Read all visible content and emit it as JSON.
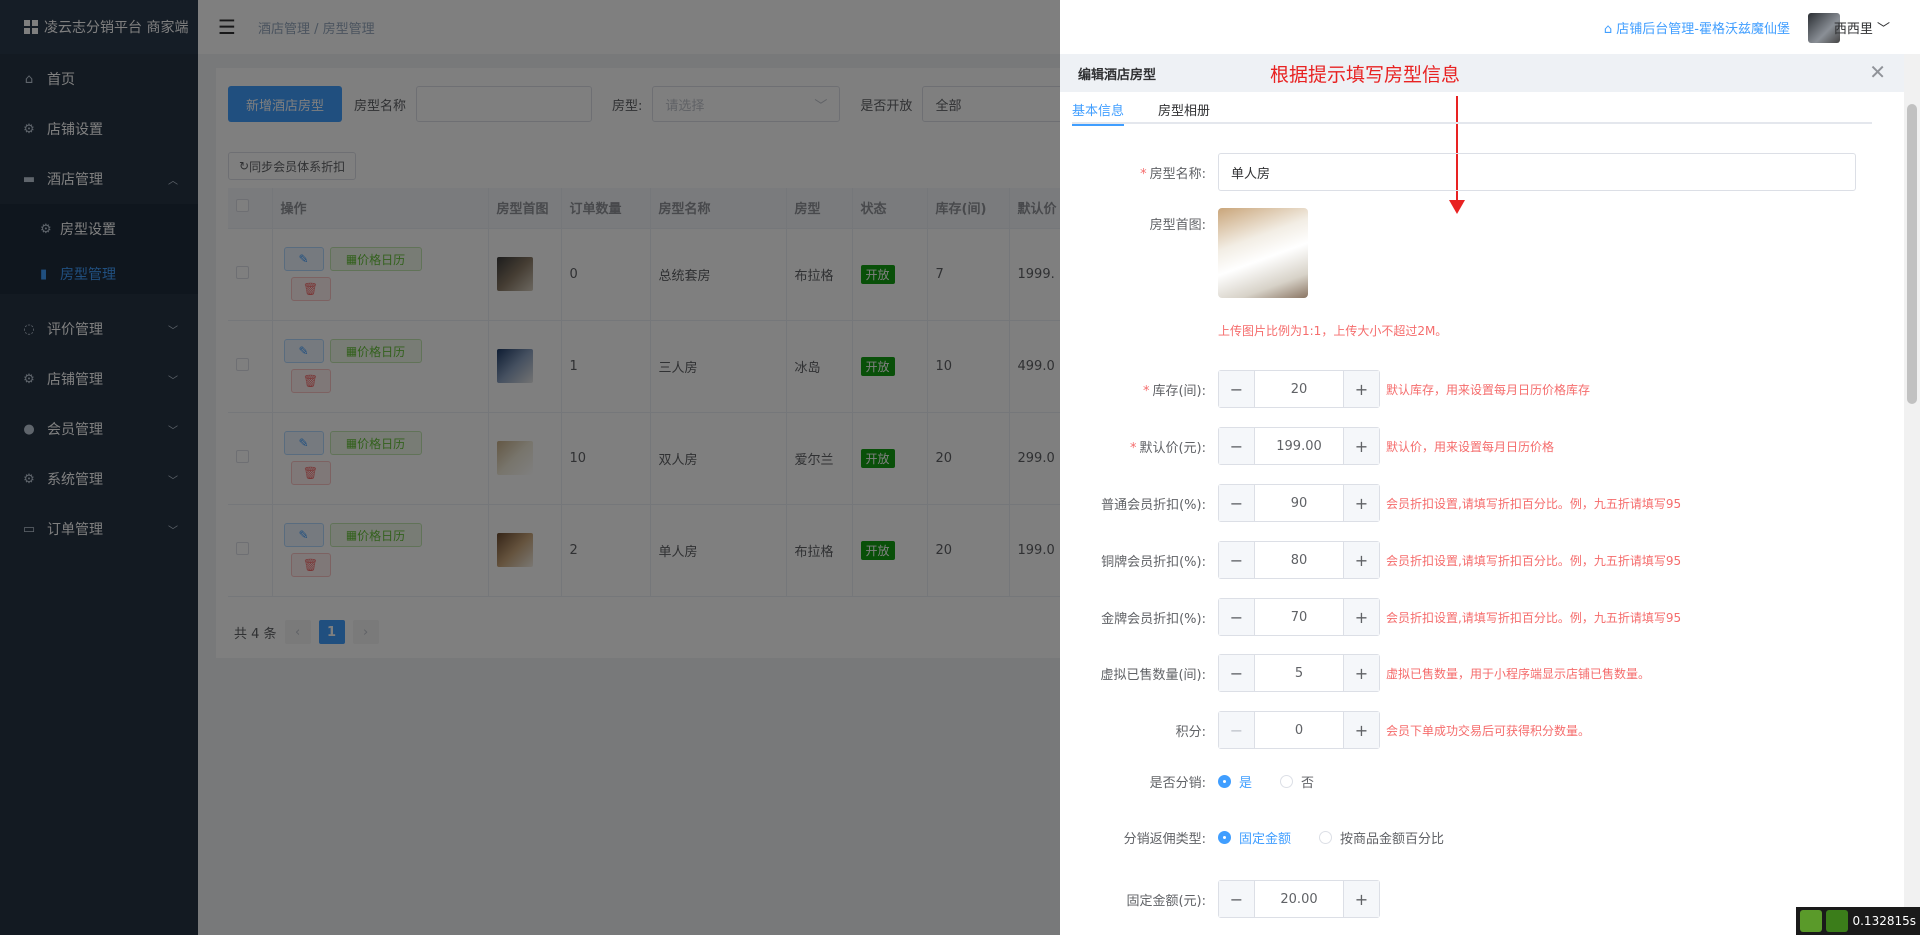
{
  "app": {
    "title": "凌云志分销平台 商家端"
  },
  "sidebar": {
    "items": [
      {
        "label": "首页",
        "icon": "home-icon"
      },
      {
        "label": "店铺设置",
        "icon": "gear-icon"
      },
      {
        "label": "酒店管理",
        "icon": "hotel-icon",
        "expanded": true,
        "children": [
          {
            "label": "房型设置"
          },
          {
            "label": "房型管理",
            "active": true
          }
        ]
      },
      {
        "label": "评价管理",
        "icon": "comment-icon"
      },
      {
        "label": "店铺管理",
        "icon": "gear-icon"
      },
      {
        "label": "会员管理",
        "icon": "user-icon"
      },
      {
        "label": "系统管理",
        "icon": "gear-icon"
      },
      {
        "label": "订单管理",
        "icon": "monitor-icon"
      }
    ]
  },
  "navbar": {
    "breadcrumb": "酒店管理 / 房型管理",
    "store_link": "店铺后台管理-霍格沃兹魔仙堡",
    "user": "西西里"
  },
  "toolbar": {
    "add_button": "新增酒店房型",
    "name_label": "房型名称",
    "type_label": "房型:",
    "type_placeholder": "请选择",
    "open_label": "是否开放",
    "open_value": "全部",
    "sync_button": "同步会员体系折扣"
  },
  "table": {
    "headers": [
      "操作",
      "房型首图",
      "订单数量",
      "房型名称",
      "房型",
      "状态",
      "库存(间)",
      "默认价"
    ],
    "calendar_label": "价格日历",
    "rows": [
      {
        "orders": "0",
        "name": "总统套房",
        "type": "布拉格",
        "status": "开放",
        "stock": "7",
        "price": "1999."
      },
      {
        "orders": "1",
        "name": "三人房",
        "type": "冰岛",
        "status": "开放",
        "stock": "10",
        "price": "499.0"
      },
      {
        "orders": "10",
        "name": "双人房",
        "type": "爱尔兰",
        "status": "开放",
        "stock": "20",
        "price": "299.0"
      },
      {
        "orders": "2",
        "name": "单人房",
        "type": "布拉格",
        "status": "开放",
        "stock": "20",
        "price": "199.0"
      }
    ]
  },
  "pagination": {
    "total": "共 4 条",
    "current": "1"
  },
  "drawer": {
    "title": "编辑酒店房型",
    "annotation": "根据提示填写房型信息",
    "tabs": [
      "基本信息",
      "房型相册"
    ],
    "fields": {
      "name_label": "房型名称:",
      "name_value": "单人房",
      "image_label": "房型首图:",
      "image_hint": "上传图片比例为1:1，上传大小不超过2M。",
      "stock_label": "库存(间):",
      "stock_value": "20",
      "stock_hint": "默认库存，用来设置每月日历价格库存",
      "price_label": "默认价(元):",
      "price_value": "199.00",
      "price_hint": "默认价，用来设置每月日历价格",
      "normal_label": "普通会员折扣(%):",
      "normal_value": "90",
      "bronze_label": "铜牌会员折扣(%):",
      "bronze_value": "80",
      "gold_label": "金牌会员折扣(%):",
      "gold_value": "70",
      "discount_hint": "会员折扣设置,请填写折扣百分比。例，九五折请填写95",
      "virtual_label": "虚拟已售数量(间):",
      "virtual_value": "5",
      "virtual_hint": "虚拟已售数量，用于小程序端显示店铺已售数量。",
      "points_label": "积分:",
      "points_value": "0",
      "points_hint": "会员下单成功交易后可获得积分数量。",
      "dist_label": "是否分销:",
      "dist_yes": "是",
      "dist_no": "否",
      "rebate_label": "分销返佣类型:",
      "rebate_fixed": "固定金额",
      "rebate_percent": "按商品金额百分比",
      "fixed_label": "固定金额(元):",
      "fixed_value": "20.00"
    }
  },
  "timer": "0.132815s"
}
